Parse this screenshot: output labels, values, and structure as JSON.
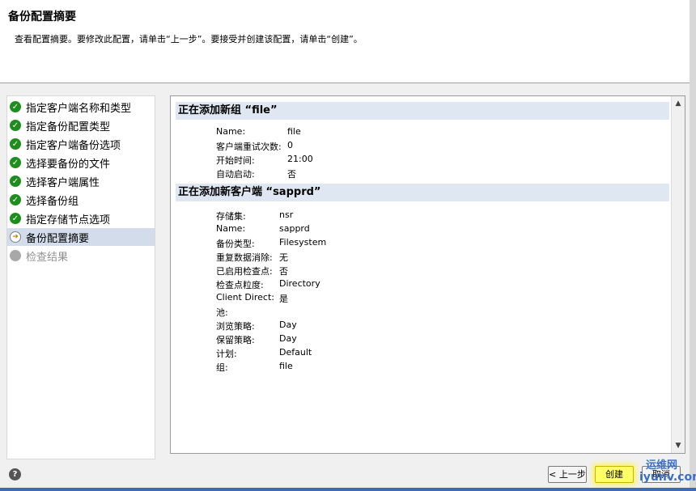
{
  "header": {
    "title": "备份配置摘要",
    "subtitle": "查看配置摘要。要修改此配置，请单击“上一步”。要接受并创建该配置，请单击“创建”。"
  },
  "steps": [
    {
      "label": "指定客户端名称和类型",
      "state": "done"
    },
    {
      "label": "指定备份配置类型",
      "state": "done"
    },
    {
      "label": "指定客户端备份选项",
      "state": "done"
    },
    {
      "label": "选择要备份的文件",
      "state": "done"
    },
    {
      "label": "选择客户端属性",
      "state": "done"
    },
    {
      "label": "选择备份组",
      "state": "done"
    },
    {
      "label": "指定存储节点选项",
      "state": "done"
    },
    {
      "label": "备份配置摘要",
      "state": "current"
    },
    {
      "label": "检查结果",
      "state": "pending"
    }
  ],
  "summary": {
    "group_section": {
      "title": "正在添加新组 “file”",
      "rows": [
        {
          "key": "Name:",
          "value": "file"
        },
        {
          "key": "客户端重试次数:",
          "value": "0"
        },
        {
          "key": "开始时间:",
          "value": "21:00"
        },
        {
          "key": "自动启动:",
          "value": "否"
        }
      ]
    },
    "client_section": {
      "title": "正在添加新客户端 “sapprd”",
      "rows": [
        {
          "key": "存储集:",
          "value": "nsr"
        },
        {
          "key": "Name:",
          "value": "sapprd"
        },
        {
          "key": "备份类型:",
          "value": "Filesystem"
        },
        {
          "key": "重复数据消除:",
          "value": "无"
        },
        {
          "key": "已启用检查点:",
          "value": "否"
        },
        {
          "key": "检查点粒度:",
          "value": "Directory"
        },
        {
          "key": "Client Direct:",
          "value": "是"
        },
        {
          "key": "池:",
          "value": ""
        },
        {
          "key": "浏览策略:",
          "value": "Day"
        },
        {
          "key": "保留策略:",
          "value": "Day"
        },
        {
          "key": "计划:",
          "value": "Default"
        },
        {
          "key": "组:",
          "value": "file"
        }
      ]
    }
  },
  "buttons": {
    "back": "< 上一步",
    "create": "创建",
    "cancel": "取消"
  },
  "watermark": {
    "top": "运维网",
    "bottom": "iyunv.com"
  },
  "icons": {
    "done": "check-circle-icon",
    "current": "arrow-circle-icon",
    "pending": "gray-circle-icon",
    "help": "help-icon"
  }
}
